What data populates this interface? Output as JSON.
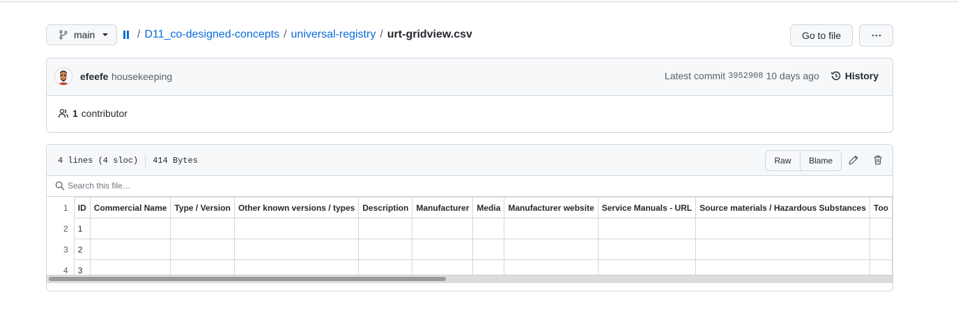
{
  "repo": {
    "branch": "main",
    "breadcrumb": [
      "D11_co-designed-concepts",
      "universal-registry"
    ],
    "filename": "urt-gridview.csv",
    "goto_file_label": "Go to file",
    "more_label": "···"
  },
  "commit": {
    "author": "efeefe",
    "message": "housekeeping",
    "latest_label": "Latest commit",
    "sha": "3952908",
    "time": "10 days ago",
    "history_label": "History",
    "contributors_count": "1",
    "contributors_label": "contributor"
  },
  "file": {
    "lines": "4 lines (4 sloc)",
    "size": "414 Bytes",
    "raw_label": "Raw",
    "blame_label": "Blame",
    "search_placeholder": "Search this file…"
  },
  "table": {
    "headers": [
      "ID",
      "Commercial Name",
      "Type / Version",
      "Other known versions / types",
      "Description",
      "Manufacturer",
      "Media",
      "Manufacturer website",
      "Service Manuals - URL",
      "Source materials / Hazardous Substances",
      "Too"
    ],
    "rows": [
      {
        "line": "2",
        "cells": [
          "1",
          "",
          "",
          "",
          "",
          "",
          "",
          "",
          "",
          "",
          ""
        ]
      },
      {
        "line": "3",
        "cells": [
          "2",
          "",
          "",
          "",
          "",
          "",
          "",
          "",
          "",
          "",
          ""
        ]
      },
      {
        "line": "4",
        "cells": [
          "3",
          "",
          "",
          "",
          "",
          "",
          "",
          "",
          "",
          "",
          ""
        ]
      }
    ],
    "header_line": "1"
  },
  "icons": {
    "branch": "git-branch-icon",
    "root": "repo-root-icon",
    "history": "history-icon",
    "contributors": "people-icon",
    "edit": "pencil-icon",
    "delete": "trash-icon",
    "search": "search-icon"
  },
  "colors": {
    "link": "#0969da",
    "border": "#d0d7de",
    "subtle_bg": "#f6f8fa",
    "muted_text": "#57606a"
  }
}
